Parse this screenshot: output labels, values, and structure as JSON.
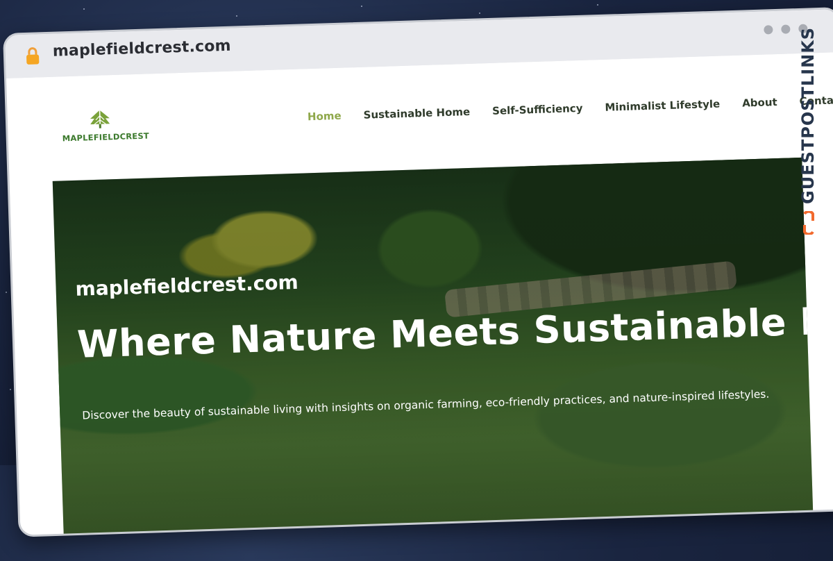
{
  "browser": {
    "url": "maplefieldcrest.com"
  },
  "site": {
    "logo_text": "MAPLEFIELDCREST",
    "nav": [
      {
        "label": "Home",
        "active": true
      },
      {
        "label": "Sustainable Home",
        "active": false
      },
      {
        "label": "Self-Sufficiency",
        "active": false
      },
      {
        "label": "Minimalist Lifestyle",
        "active": false
      },
      {
        "label": "About",
        "active": false
      },
      {
        "label": "Contact",
        "active": false
      }
    ],
    "hero": {
      "site_name": "maplefieldcrest.com",
      "title": "Where Nature Meets Sustainable Living",
      "subtitle": "Discover the beauty of sustainable living with insights on organic farming, eco-friendly practices, and nature-inspired lifestyles."
    }
  },
  "overlay_brand": "GUESTPOSTLINKS",
  "colors": {
    "nav_active": "#8fa84b",
    "logo_green": "#3c7a2d",
    "brand_orange": "#f26a2e",
    "brand_navy": "#27364c"
  }
}
